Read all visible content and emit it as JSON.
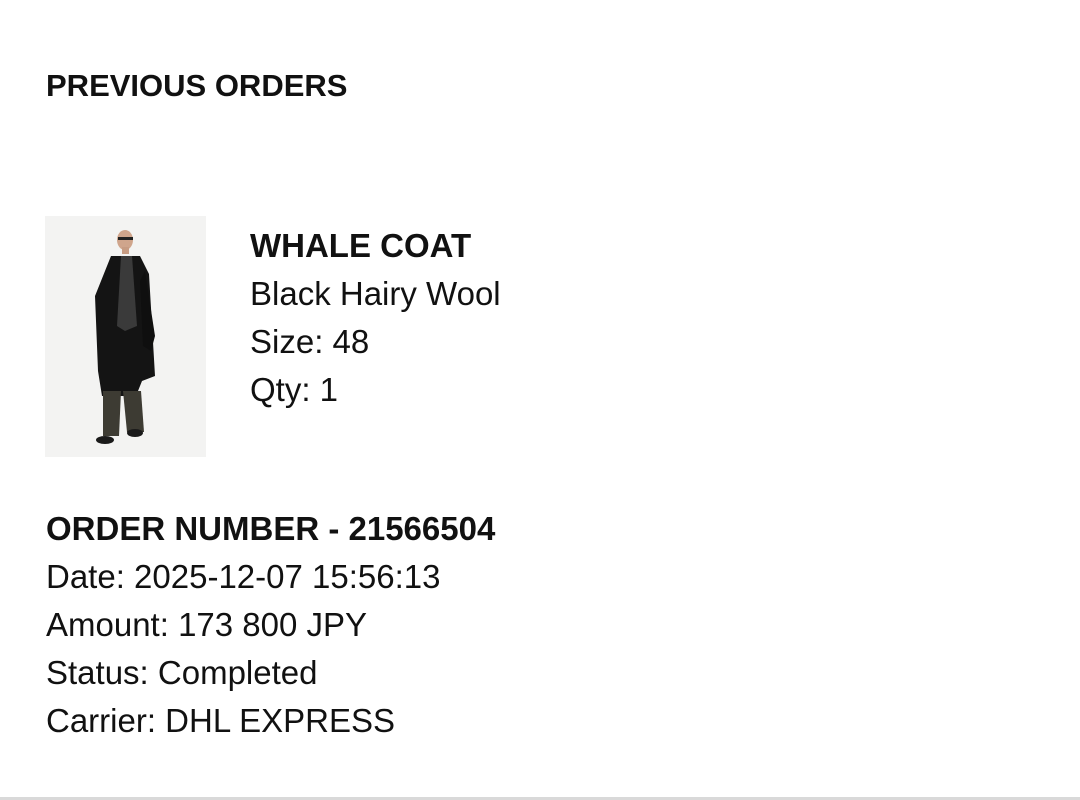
{
  "page": {
    "title": "PREVIOUS ORDERS"
  },
  "product": {
    "image_icon": "coat-product-photo",
    "name": "WHALE COAT",
    "color": "Black Hairy Wool",
    "size": "Size: 48",
    "qty": "Qty: 1"
  },
  "order": {
    "number": "ORDER NUMBER - 21566504",
    "date": "Date: 2025-12-07 15:56:13",
    "amount": "Amount: 173 800 JPY",
    "status": "Status: Completed",
    "carrier": "Carrier: DHL EXPRESS"
  },
  "colors": {
    "text": "#111111",
    "background": "#ffffff",
    "image_background": "#f3f3f2"
  }
}
